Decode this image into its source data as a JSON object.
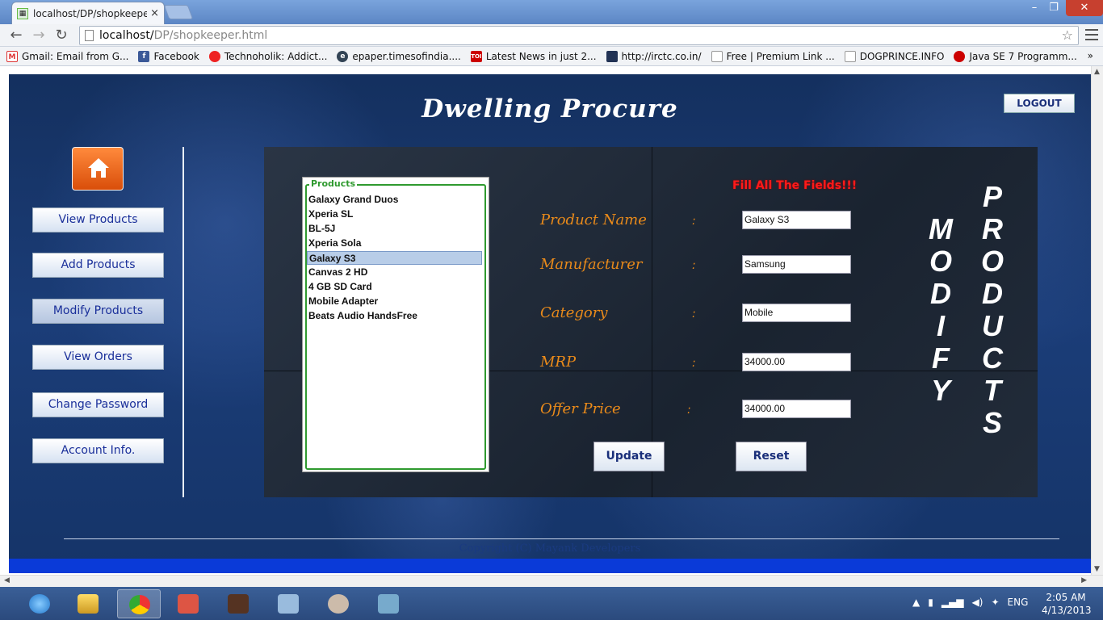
{
  "browser": {
    "tab_title": "localhost/DP/shopkeeper.",
    "tab_close": "×",
    "window": {
      "minimize": "–",
      "maximize": "❐",
      "close": "✕"
    },
    "nav": {
      "back": "←",
      "forward": "→",
      "reload": "↻"
    },
    "url_host": "localhost/",
    "url_path": "DP/shopkeeper.html",
    "bookmarks": [
      {
        "label": "Gmail: Email from G...",
        "icon": "gmail-icon",
        "color": "#d33"
      },
      {
        "label": "Facebook",
        "icon": "facebook-icon",
        "color": "#3b5998"
      },
      {
        "label": "Technoholik: Addict...",
        "icon": "technoholik-icon",
        "color": "#e22"
      },
      {
        "label": "epaper.timesofindia....",
        "icon": "epaper-icon",
        "color": "#345"
      },
      {
        "label": "Latest News in just 2...",
        "icon": "toi-icon",
        "color": "#c00"
      },
      {
        "label": "http://irctc.co.in/",
        "icon": "irctc-icon",
        "color": "#235"
      },
      {
        "label": "Free | Premium Link ...",
        "icon": "page-icon",
        "color": "#999"
      },
      {
        "label": "DOGPRINCE.INFO",
        "icon": "page-icon",
        "color": "#999"
      },
      {
        "label": "Java SE 7 Programm...",
        "icon": "oracle-icon",
        "color": "#c00"
      }
    ],
    "more": "»"
  },
  "app": {
    "title": "Dwelling Procure",
    "logout_label": "LOGOUT",
    "sidebar": [
      {
        "label": "View Products"
      },
      {
        "label": "Add Products"
      },
      {
        "label": "Modify Products"
      },
      {
        "label": "View Orders"
      },
      {
        "label": "Change Password"
      },
      {
        "label": "Account Info."
      }
    ],
    "products_legend": "Products",
    "products": [
      "Galaxy Grand Duos",
      "Xperia SL",
      "BL-5J",
      "Xperia Sola",
      "Galaxy S3",
      "Canvas 2 HD",
      "4 GB SD Card",
      "Mobile Adapter",
      "Beats Audio HandsFree"
    ],
    "selected_product": "Galaxy S3",
    "warning": "Fill All The Fields!!!",
    "fields": [
      {
        "label": "Product Name",
        "value": "Galaxy S3"
      },
      {
        "label": "Manufacturer",
        "value": "Samsung"
      },
      {
        "label": "Category",
        "value": "Mobile"
      },
      {
        "label": "MRP",
        "value": "34000.00"
      },
      {
        "label": "Offer Price",
        "value": "34000.00"
      }
    ],
    "colon": ":",
    "update_label": "Update",
    "reset_label": "Reset",
    "vertical_word_1": "MODIFY",
    "vertical_word_2": "PRODUCTS",
    "copyright": "Copyright (C) Mayank Developers"
  },
  "taskbar": {
    "lang": "ENG",
    "time": "2:05 AM",
    "date": "4/13/2013"
  },
  "colors": {
    "accent_orange": "#e98a1a",
    "warning_red": "#ff1a1a",
    "list_border_green": "#2f9a2f"
  }
}
